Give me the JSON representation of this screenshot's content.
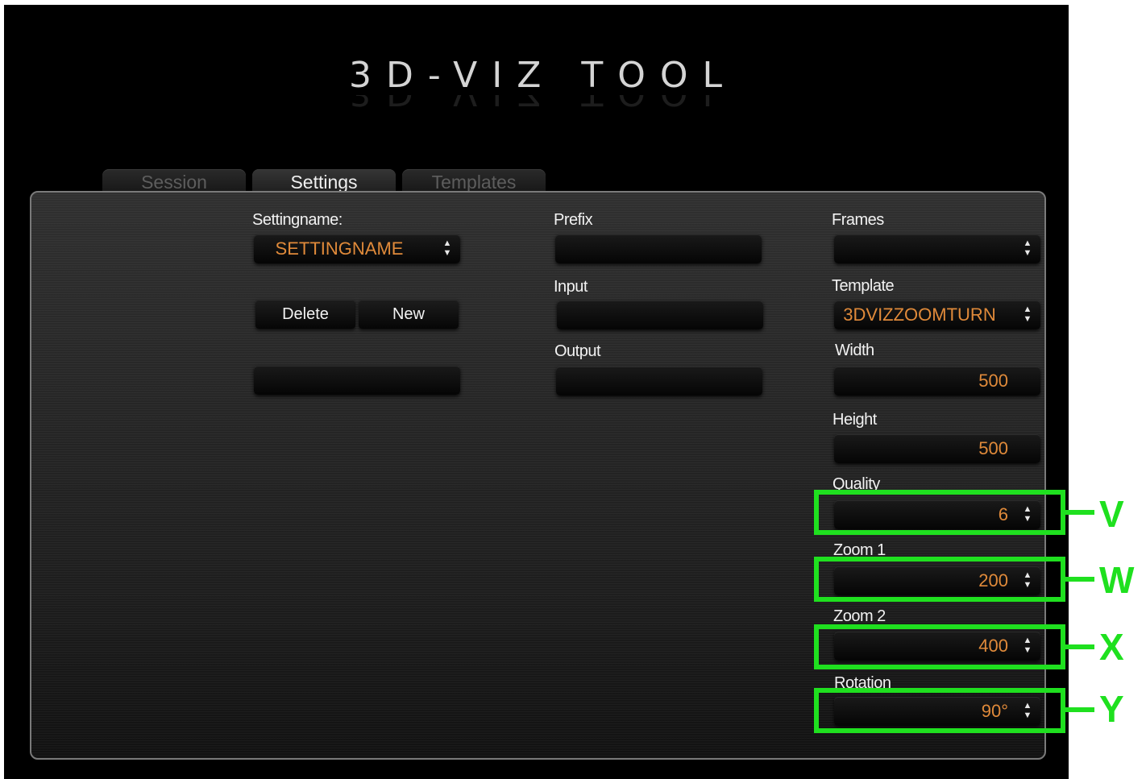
{
  "app": {
    "title": "3D-VIZ TOOL"
  },
  "tabs": [
    "Session",
    "Settings",
    "Templates"
  ],
  "settings": {
    "settingname_label": "Settingname:",
    "settingname_value": "SETTINGNAME",
    "delete_label": "Delete",
    "new_label": "New",
    "extra_value": ""
  },
  "paths": {
    "prefix_label": "Prefix",
    "prefix_value": "",
    "input_label": "Input",
    "input_value": "",
    "output_label": "Output",
    "output_value": ""
  },
  "params": {
    "frames_label": "Frames",
    "frames_value": "",
    "template_label": "Template",
    "template_value": "3DVIZZOOMTURN",
    "width_label": "Width",
    "width_value": "500",
    "height_label": "Height",
    "height_value": "500",
    "quality_label": "Quality",
    "quality_value": "6",
    "zoom1_label": "Zoom 1",
    "zoom1_value": "200",
    "zoom2_label": "Zoom 2",
    "zoom2_value": "400",
    "rotation_label": "Rotation",
    "rotation_value": "90°"
  },
  "annotations": {
    "v": "V",
    "w": "W",
    "x": "X",
    "y": "Y"
  },
  "colors": {
    "value_text": "#e08a3a",
    "highlight": "#1fe01f"
  },
  "icons": {
    "spinner": "up-down-spinner-icon"
  }
}
